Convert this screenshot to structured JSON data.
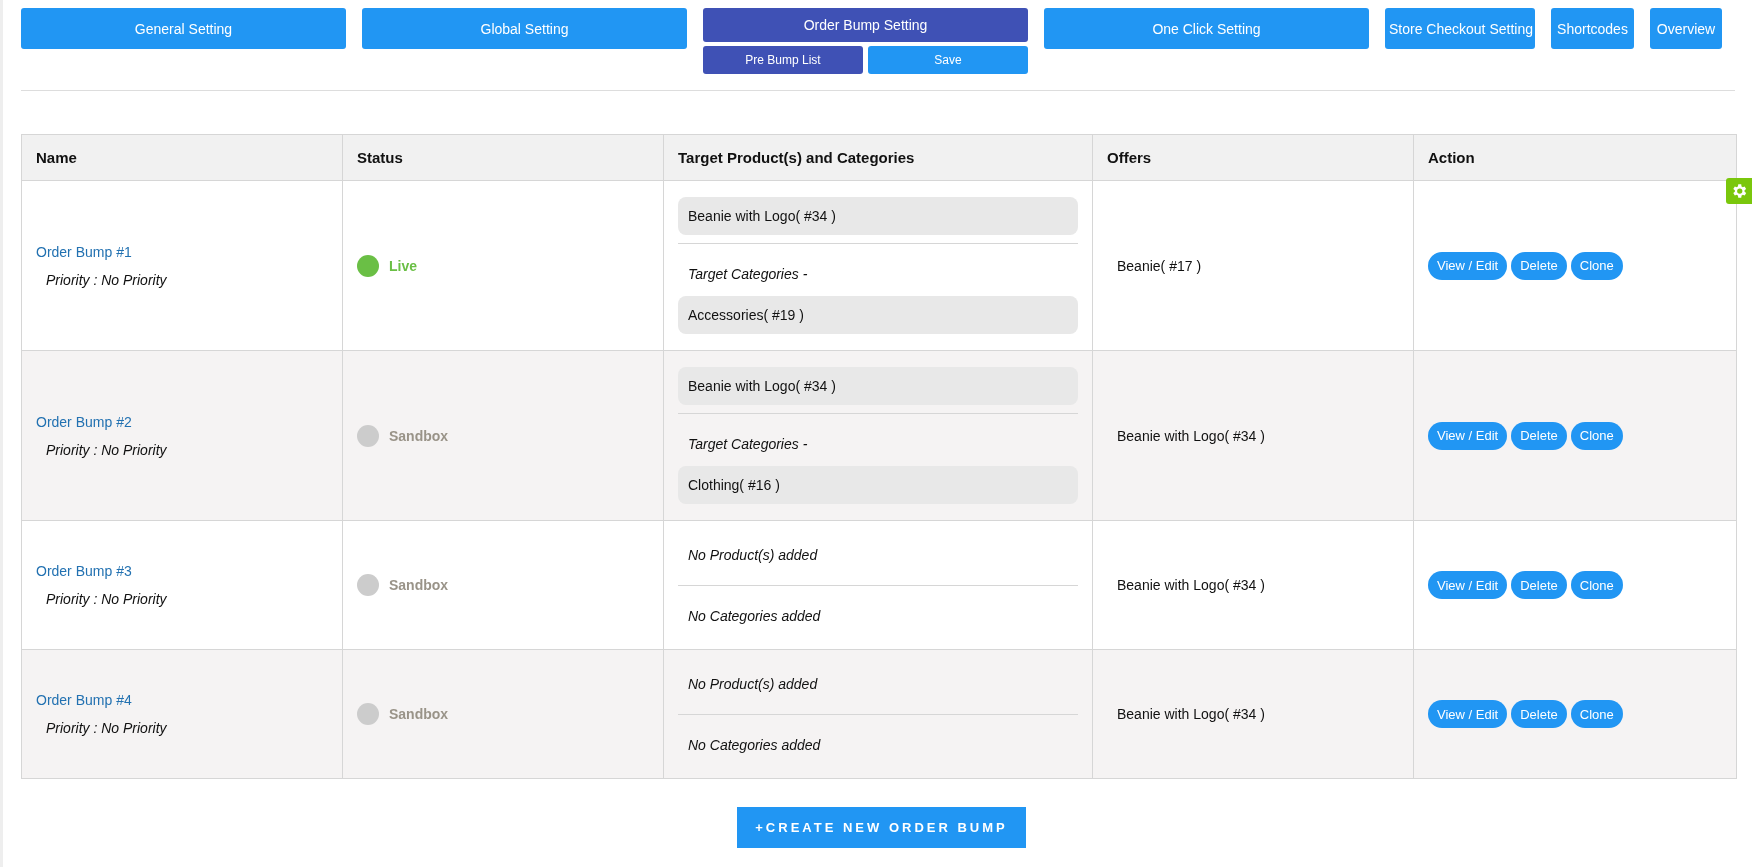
{
  "tabs": [
    {
      "label": "General Setting",
      "selected": false
    },
    {
      "label": "Global Setting",
      "selected": false
    },
    {
      "label": "Order Bump Setting",
      "selected": true
    },
    {
      "label": "One Click Setting",
      "selected": false
    },
    {
      "label": "Store Checkout Setting",
      "selected": false
    },
    {
      "label": "Shortcodes",
      "selected": false
    },
    {
      "label": "Overview",
      "selected": false
    }
  ],
  "sub_buttons": [
    {
      "label": "Pre Bump List",
      "selected": true
    },
    {
      "label": "Save",
      "selected": false
    }
  ],
  "table": {
    "columns": [
      "Name",
      "Status",
      "Target Product(s) and Categories",
      "Offers",
      "Action"
    ],
    "rows": [
      {
        "name": "Order Bump #1",
        "priority": "Priority : No Priority",
        "status": {
          "label": "Live",
          "live": true
        },
        "target": {
          "products": [
            "Beanie with Logo( #34 )"
          ],
          "categories_label": "Target Categories -",
          "categories": [
            "Accessories( #19 )"
          ]
        },
        "offer": "Beanie( #17 )",
        "actions": [
          "View / Edit",
          "Delete",
          "Clone"
        ]
      },
      {
        "name": "Order Bump #2",
        "priority": "Priority : No Priority",
        "status": {
          "label": "Sandbox",
          "live": false
        },
        "target": {
          "products": [
            "Beanie with Logo( #34 )"
          ],
          "categories_label": "Target Categories -",
          "categories": [
            "Clothing( #16 )"
          ]
        },
        "offer": "Beanie with Logo( #34 )",
        "actions": [
          "View / Edit",
          "Delete",
          "Clone"
        ]
      },
      {
        "name": "Order Bump #3",
        "priority": "Priority : No Priority",
        "status": {
          "label": "Sandbox",
          "live": false
        },
        "target": {
          "no_products": "No Product(s) added",
          "no_categories": "No Categories added"
        },
        "offer": "Beanie with Logo( #34 )",
        "actions": [
          "View / Edit",
          "Delete",
          "Clone"
        ]
      },
      {
        "name": "Order Bump #4",
        "priority": "Priority : No Priority",
        "status": {
          "label": "Sandbox",
          "live": false
        },
        "target": {
          "no_products": "No Product(s) added",
          "no_categories": "No Categories added"
        },
        "offer": "Beanie with Logo( #34 )",
        "actions": [
          "View / Edit",
          "Delete",
          "Clone"
        ]
      }
    ]
  },
  "create_button": "+CREATE NEW ORDER BUMP"
}
